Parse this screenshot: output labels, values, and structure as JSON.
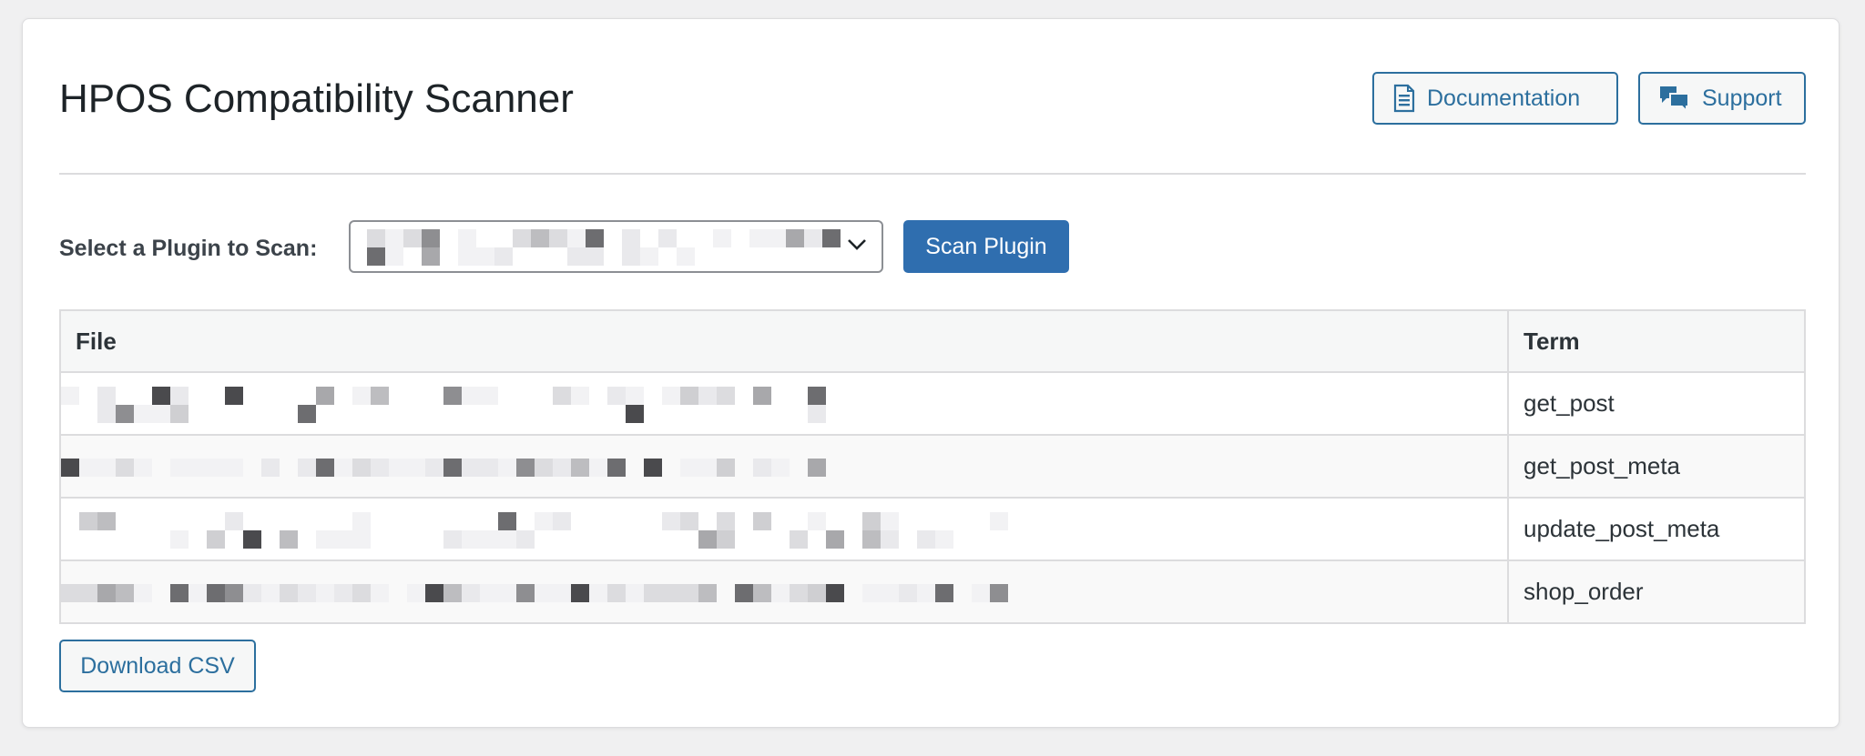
{
  "header": {
    "title": "HPOS Compatibility Scanner",
    "documentation_label": "Documentation",
    "support_label": "Support"
  },
  "scanner": {
    "select_label": "Select a Plugin to Scan:",
    "scan_button_label": "Scan Plugin"
  },
  "table": {
    "columns": [
      "File",
      "Term"
    ],
    "rows": [
      {
        "term": "get_post"
      },
      {
        "term": "get_post_meta"
      },
      {
        "term": "update_post_meta"
      },
      {
        "term": "shop_order"
      }
    ]
  },
  "actions": {
    "download_label": "Download CSV"
  },
  "colors": {
    "accent": "#2c6f9e",
    "primary_button": "#2f6eaf",
    "border": "#dcdcde"
  }
}
